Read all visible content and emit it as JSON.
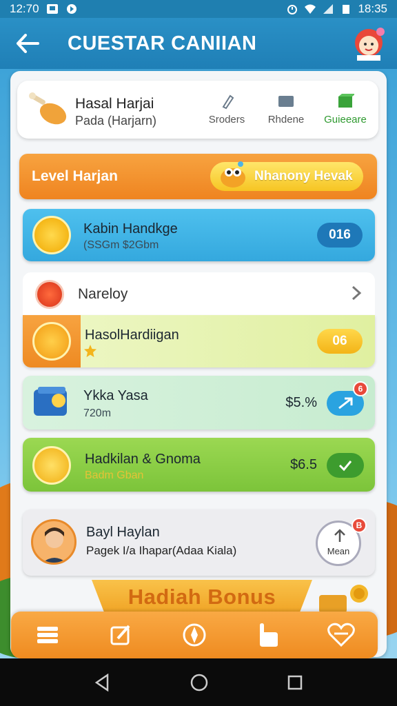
{
  "status_bar": {
    "time_left": "12:70",
    "time_right": "18:35"
  },
  "app_bar": {
    "title": "CUESTAR CANIIAN"
  },
  "header_card": {
    "title": "Hasal Harjai",
    "subtitle": "Pada (Harjarn)",
    "tabs": [
      {
        "label": "Sroders",
        "icon": "pencil-icon"
      },
      {
        "label": "Rhdene",
        "icon": "folder-icon"
      },
      {
        "label": "Guieeare",
        "icon": "box-icon"
      }
    ]
  },
  "level_bar": {
    "label": "Level Harjan",
    "pill_text": "Nhanony Hevak"
  },
  "blue_row": {
    "title": "Kabin Handkge",
    "subtitle": "(SSGm $2Gbm",
    "value": "016"
  },
  "list_header": {
    "title": "Nareloy"
  },
  "green_row": {
    "title": "HasolHardiigan",
    "value": "06"
  },
  "mint_row": {
    "title": "Ykka Yasa",
    "subtitle": "720m",
    "value": "$5.%",
    "badge": "6"
  },
  "lime_row": {
    "title": "Hadkilan & Gnoma",
    "subtitle": "Badm Gban",
    "value": "$6.5"
  },
  "user_row": {
    "name": "Bayl Haylan",
    "detail": "Pagek I/a Ihapar(Adaa Kiala)",
    "action_label": "Mean",
    "badge": "B"
  },
  "bonus": {
    "label": "Hadiah Bonus"
  },
  "bottom_nav": [
    "list-icon",
    "edit-icon",
    "compass-icon",
    "hand-icon",
    "heart-icon"
  ],
  "colors": {
    "primary": "#1f7fb0",
    "accent": "#ef8420",
    "green": "#7cc43a",
    "blue": "#34a8de"
  }
}
